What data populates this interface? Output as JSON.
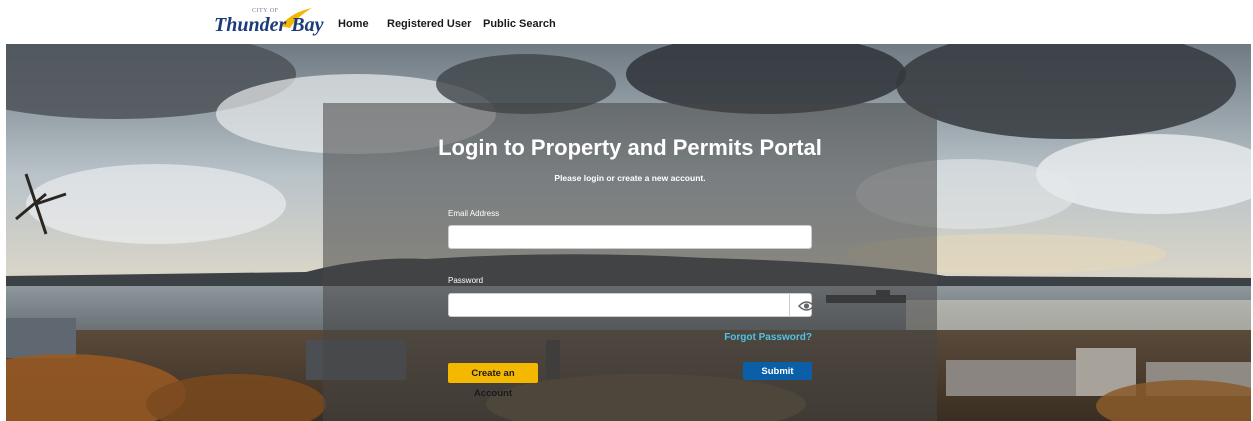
{
  "header": {
    "logo": {
      "small_text": "CITY OF",
      "brand_text": "Thunder Bay"
    },
    "nav": [
      {
        "label": "Home"
      },
      {
        "label": "Registered User"
      },
      {
        "label": "Public Search"
      }
    ]
  },
  "login": {
    "title": "Login to Property and Permits Portal",
    "subtitle": "Please login or create a new account.",
    "email_label": "Email Address",
    "email_value": "",
    "password_label": "Password",
    "password_value": "",
    "show_password_icon": "eye-icon",
    "forgot_link": "Forgot Password?",
    "create_button": "Create an Account",
    "submit_button": "Submit"
  },
  "colors": {
    "brand_navy": "#1c3b7a",
    "create_button_bg": "#f5b800",
    "submit_button_bg": "#0b5ea8",
    "forgot_link": "#4ec3e8"
  }
}
